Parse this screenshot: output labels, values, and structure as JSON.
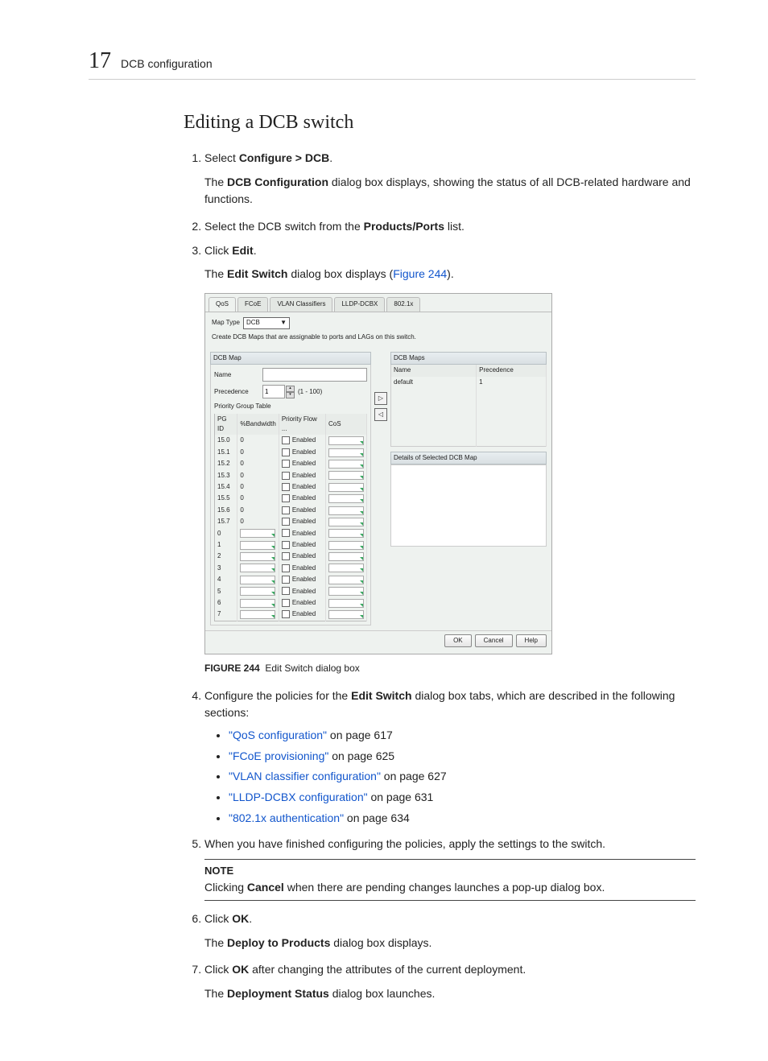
{
  "header": {
    "chapter_number": "17",
    "chapter_title": "DCB configuration"
  },
  "section_title": "Editing a DCB switch",
  "steps": {
    "s1_pre": "Select ",
    "s1_bold": "Configure > DCB",
    "s1_post": ".",
    "s1_sub_a": "The ",
    "s1_sub_b": "DCB Configuration",
    "s1_sub_c": " dialog box displays, showing the status of all DCB-related hardware and functions.",
    "s2_pre": "Select the DCB switch from the ",
    "s2_bold": "Products/Ports",
    "s2_post": " list.",
    "s3_pre": "Click ",
    "s3_bold": "Edit",
    "s3_post": ".",
    "s3_sub_a": "The ",
    "s3_sub_b": "Edit Switch",
    "s3_sub_c": " dialog box displays (",
    "s3_sub_link": "Figure 244",
    "s3_sub_d": ").",
    "s4_pre": "Configure the policies for the ",
    "s4_bold": "Edit Switch",
    "s4_post": " dialog box tabs, which are described in the following sections:",
    "links": [
      {
        "text": "\"QoS configuration\"",
        "pg": " on page 617"
      },
      {
        "text": "\"FCoE provisioning\"",
        "pg": " on page 625"
      },
      {
        "text": "\"VLAN classifier configuration\"",
        "pg": " on page 627"
      },
      {
        "text": "\"LLDP-DCBX configuration\"",
        "pg": " on page 631"
      },
      {
        "text": "\"802.1x authentication\"",
        "pg": " on page 634"
      }
    ],
    "s5": "When you have finished configuring the policies, apply the settings to the switch.",
    "note_heading": "NOTE",
    "note_a": "Clicking ",
    "note_bold": "Cancel",
    "note_b": " when there are pending changes launches a pop-up dialog box.",
    "s6_pre": "Click ",
    "s6_bold": "OK",
    "s6_post": ".",
    "s6_sub_a": "The ",
    "s6_sub_b": "Deploy to Products",
    "s6_sub_c": " dialog box displays.",
    "s7_pre": "Click ",
    "s7_bold": "OK",
    "s7_post": " after changing the attributes of the current deployment.",
    "s7_sub_a": "The ",
    "s7_sub_b": "Deployment Status",
    "s7_sub_c": " dialog box launches."
  },
  "figure": {
    "label": "FIGURE 244",
    "caption": "Edit Switch dialog box"
  },
  "dialog": {
    "tabs": [
      "QoS",
      "FCoE",
      "VLAN Classifiers",
      "LLDP-DCBX",
      "802.1x"
    ],
    "map_type_label": "Map Type",
    "map_type_value": "DCB",
    "instruction": "Create DCB Maps that are assignable to ports and LAGs on this switch.",
    "dcb_map_header": "DCB Map",
    "name_label": "Name",
    "name_value": "",
    "precedence_label": "Precedence",
    "precedence_value": "1",
    "precedence_range": "(1 - 100)",
    "pgt_header": "Priority Group Table",
    "pgt_cols": [
      "PG ID",
      "%Bandwidth",
      "Priority Flow ...",
      "CoS"
    ],
    "pgt_rows": [
      {
        "id": "15.0",
        "bw": "0",
        "pf": "Enabled"
      },
      {
        "id": "15.1",
        "bw": "0",
        "pf": "Enabled"
      },
      {
        "id": "15.2",
        "bw": "0",
        "pf": "Enabled"
      },
      {
        "id": "15.3",
        "bw": "0",
        "pf": "Enabled"
      },
      {
        "id": "15.4",
        "bw": "0",
        "pf": "Enabled"
      },
      {
        "id": "15.5",
        "bw": "0",
        "pf": "Enabled"
      },
      {
        "id": "15.6",
        "bw": "0",
        "pf": "Enabled"
      },
      {
        "id": "15.7",
        "bw": "0",
        "pf": "Enabled"
      },
      {
        "id": "0",
        "bw": "",
        "pf": "Enabled"
      },
      {
        "id": "1",
        "bw": "",
        "pf": "Enabled"
      },
      {
        "id": "2",
        "bw": "",
        "pf": "Enabled"
      },
      {
        "id": "3",
        "bw": "",
        "pf": "Enabled"
      },
      {
        "id": "4",
        "bw": "",
        "pf": "Enabled"
      },
      {
        "id": "5",
        "bw": "",
        "pf": "Enabled"
      },
      {
        "id": "6",
        "bw": "",
        "pf": "Enabled"
      },
      {
        "id": "7",
        "bw": "",
        "pf": "Enabled"
      }
    ],
    "dcb_maps_header": "DCB Maps",
    "maps_cols": [
      "Name",
      "Precedence"
    ],
    "maps_rows": [
      {
        "name": "default",
        "prec": "1"
      }
    ],
    "details_header": "Details of Selected DCB Map",
    "buttons": {
      "ok": "OK",
      "cancel": "Cancel",
      "help": "Help"
    }
  }
}
